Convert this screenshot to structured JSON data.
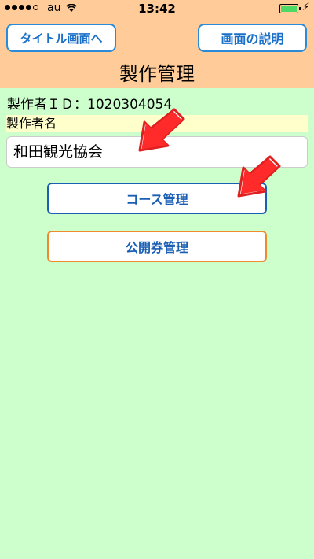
{
  "status": {
    "carrier": "au",
    "time": "13:42"
  },
  "header": {
    "back_label": "タイトル画面へ",
    "help_label": "画面の説明",
    "title": "製作管理"
  },
  "maker": {
    "id_line": "製作者ＩＤ：1020304054",
    "name_label": "製作者名",
    "name_value": "和田観光協会"
  },
  "actions": {
    "course_label": "コース管理",
    "ticket_label": "公開券管理"
  },
  "colors": {
    "header_bg": "#ffcc99",
    "body_bg": "#ccffcc",
    "accent_blue": "#1a5fb4",
    "accent_orange": "#f08a2c",
    "arrow_red": "#e02020"
  },
  "icons": [
    "signal-icon",
    "wifi-icon",
    "battery-icon",
    "charging-icon",
    "arrow-pointer-icon"
  ]
}
